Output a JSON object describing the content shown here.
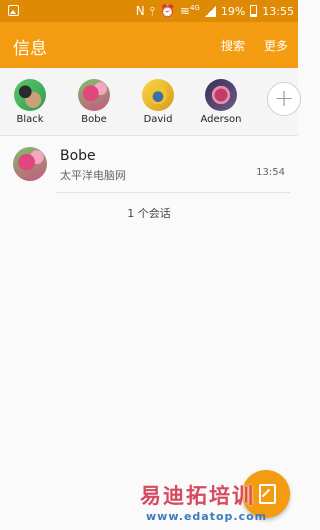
{
  "status_bar": {
    "icons": [
      "image-notification-icon",
      "nfc-icon",
      "vibrate-icon",
      "alarm-icon",
      "wifi-icon",
      "signal-icon",
      "battery-icon"
    ],
    "network": "4G",
    "battery": "19%",
    "time": "13:55"
  },
  "app_bar": {
    "title": "信息",
    "search": "搜索",
    "more": "更多",
    "color": "#f39c11"
  },
  "favorites": [
    {
      "name": "Black"
    },
    {
      "name": "Bobe"
    },
    {
      "name": "David"
    },
    {
      "name": "Aderson"
    }
  ],
  "add_contact_icon": "plus-icon",
  "conversations": [
    {
      "name": "Bobe",
      "preview": "太平洋电脑网",
      "time": "13:54"
    }
  ],
  "conversation_count": "1 个会话",
  "fab_icon": "compose-icon",
  "watermark": {
    "text": "易迪拓培训",
    "url": "www.edatop.com"
  }
}
